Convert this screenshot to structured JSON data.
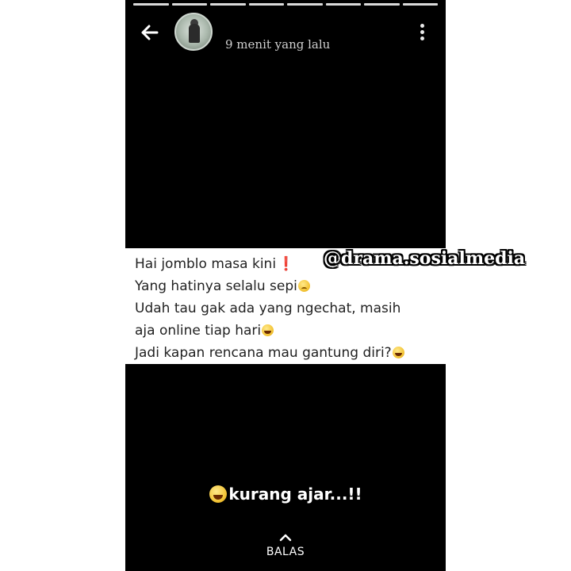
{
  "header": {
    "name": "",
    "timestamp": "9 menit yang lalu"
  },
  "caption": {
    "lines": [
      "Hai jomblo masa kini",
      "Yang hatinya selalu sepi",
      "Udah tau gak ada yang ngechat, masih",
      "aja online tiap hari",
      "Jadi kapan rencana mau gantung diri?"
    ]
  },
  "watermark": "@drama.sosialmedia",
  "reply": {
    "message": "kurang ajar...!!",
    "label": "BALAS"
  },
  "icons": {
    "back": "back-arrow-icon",
    "menu": "more-vert-icon",
    "exclamation": "exclamation-icon",
    "sad": "sad-face-emoji",
    "laugh": "laugh-cry-emoji",
    "chevron": "chevron-up-icon"
  },
  "colors": {
    "background": "#000000",
    "caption_bg": "#ffffff",
    "text": "#ffffff"
  }
}
